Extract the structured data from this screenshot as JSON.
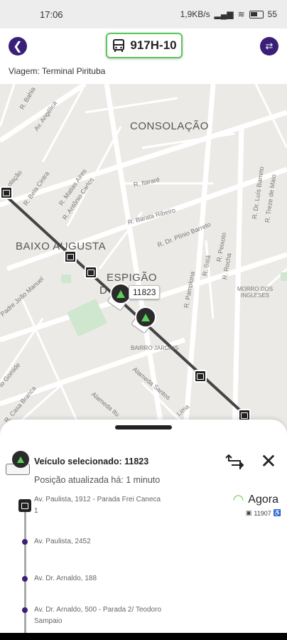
{
  "status_bar": {
    "time": "17:06",
    "network_speed": "1,9KB/s",
    "battery": "55"
  },
  "header": {
    "route_code": "917H-10",
    "trip_label": "Viagem: Terminal Pirituba"
  },
  "map": {
    "areas": {
      "consolacao": "CONSOLAÇÃO",
      "baixo_augusta": "BAIXO AUGUSTA",
      "espigao": "ESPIGÃO",
      "espigao_2": "D",
      "morro": "MORRO DOS INGLESES",
      "bairro_jardins": "BAIRRO JARDINS"
    },
    "streets": {
      "bahia": "R. Bahia",
      "angelica": "Av. Angélica",
      "bela_cintra": "R. Bela Cintra",
      "matias_aires": "R. Matias Aires",
      "antonio_carlos": "R. Antônio Carlos",
      "itarare": "R. Itararé",
      "barata_ribeiro": "R. Barata Ribeiro",
      "plinio_barreto": "R. Dr. Plínio Barreto",
      "treze_maio": "R. Treze de Maio",
      "luis_barreto": "R. Dr. Luís Barreto",
      "joao_manoel": "Padre João Manuel",
      "pamplona": "R. Pamplona",
      "saint": "R. Saiá",
      "rocha": "R. Rocha",
      "peixoto": "R. Peixoto",
      "gomide": "to Gomide",
      "casa_branca": "R. Casa Branca",
      "alameda_santos": "Alameda Santos",
      "alameda_itu": "Alameda Itu",
      "lima": "Lima",
      "consol": "olação"
    },
    "selected_vehicle_tooltip": "11823"
  },
  "sheet": {
    "selected_title": "Veículo selecionado: 11823",
    "updated_text": "Posição atualizada há: 1 minuto",
    "stops": [
      {
        "name": "Av. Paulista, 1912 - Parada Frei Caneca 1"
      },
      {
        "name": "Av. Paulista, 2452"
      },
      {
        "name": "Av. Dr. Arnaldo, 188"
      },
      {
        "name": "Av. Dr. Arnaldo, 500 - Parada 2/ Teodoro Sampaio"
      }
    ],
    "eta_label": "Agora",
    "eta_vehicle": "11907"
  },
  "colors": {
    "brand_purple": "#3a1f78",
    "accent_green": "#5bc85b",
    "route_line": "#444444"
  }
}
